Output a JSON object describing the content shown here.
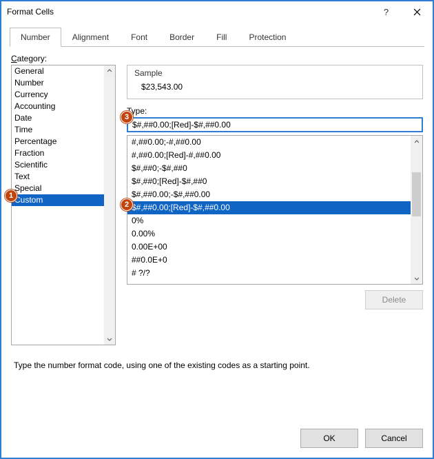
{
  "window": {
    "title": "Format Cells"
  },
  "tabs": [
    {
      "label": "Number",
      "active": true
    },
    {
      "label": "Alignment"
    },
    {
      "label": "Font"
    },
    {
      "label": "Border"
    },
    {
      "label": "Fill"
    },
    {
      "label": "Protection"
    }
  ],
  "labels": {
    "category": "Category:",
    "sample": "Sample",
    "type": "Type:",
    "description": "Type the number format code, using one of the existing codes as a starting point."
  },
  "categories": {
    "items": [
      {
        "label": "General"
      },
      {
        "label": "Number"
      },
      {
        "label": "Currency"
      },
      {
        "label": "Accounting"
      },
      {
        "label": "Date"
      },
      {
        "label": "Time"
      },
      {
        "label": "Percentage"
      },
      {
        "label": "Fraction"
      },
      {
        "label": "Scientific"
      },
      {
        "label": "Text"
      },
      {
        "label": "Special"
      },
      {
        "label": "Custom",
        "selected": true
      }
    ]
  },
  "sample": {
    "value": "$23,543.00"
  },
  "type": {
    "value": "$#,##0.00;[Red]-$#,##0.00",
    "list": [
      {
        "label": "#,##0.00;-#,##0.00"
      },
      {
        "label": "#,##0.00;[Red]-#,##0.00"
      },
      {
        "label": "$#,##0;-$#,##0"
      },
      {
        "label": "$#,##0;[Red]-$#,##0"
      },
      {
        "label": "$#,##0.00;-$#,##0.00"
      },
      {
        "label": "$#,##0.00;[Red]-$#,##0.00",
        "selected": true
      },
      {
        "label": "0%"
      },
      {
        "label": "0.00%"
      },
      {
        "label": "0.00E+00"
      },
      {
        "label": "##0.0E+0"
      },
      {
        "label": "# ?/?"
      }
    ]
  },
  "buttons": {
    "delete": "Delete",
    "ok": "OK",
    "cancel": "Cancel"
  },
  "annotations": {
    "one": "1",
    "two": "2",
    "three": "3"
  }
}
